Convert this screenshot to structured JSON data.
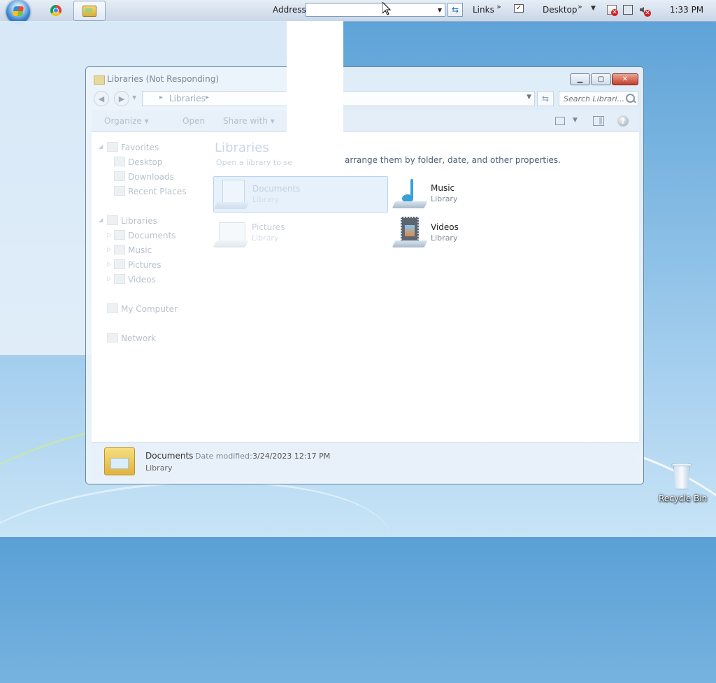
{
  "taskbar": {
    "address_label": "Address",
    "address_value": "",
    "links_label": "Links",
    "desktop_label": "Desktop",
    "chevron": "»",
    "clock": "1:33 PM"
  },
  "window": {
    "title": "Libraries (Not Responding)",
    "breadcrumb": "Libraries",
    "search_placeholder": "Search Librari...",
    "toolbar": {
      "organize": "Organize ▾",
      "open": "Open",
      "share_with": "Share with ▾"
    },
    "nav": {
      "favorites": "Favorites",
      "desktop": "Desktop",
      "downloads": "Downloads",
      "recent_places": "Recent Places",
      "libraries": "Libraries",
      "documents": "Documents",
      "music": "Music",
      "pictures": "Pictures",
      "videos": "Videos",
      "my_computer": "My Computer",
      "network": "Network"
    },
    "heading": "Libraries",
    "subtext_left": "Open a library to se",
    "subtext_right": "arrange them by folder, date, and other properties.",
    "libraries": [
      {
        "name": "Documents",
        "type": "Library"
      },
      {
        "name": "Music",
        "type": "Library"
      },
      {
        "name": "Pictures",
        "type": "Library"
      },
      {
        "name": "Videos",
        "type": "Library"
      }
    ],
    "details": {
      "name": "Documents",
      "date_label": "Date modified:",
      "date_value": "3/24/2023 12:17 PM",
      "type": "Library"
    }
  },
  "desktop": {
    "recycle_bin": "Recycle Bin"
  }
}
